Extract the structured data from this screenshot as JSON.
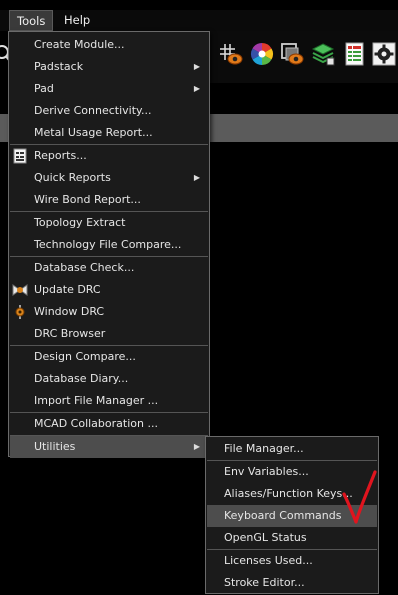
{
  "menubar": {
    "items": [
      {
        "label": "Tools",
        "active": true
      },
      {
        "label": "Help",
        "active": false
      }
    ]
  },
  "tools_menu": {
    "items": [
      {
        "label": "Create Module...",
        "submenu": false
      },
      {
        "label": "Padstack",
        "submenu": true
      },
      {
        "label": "Pad",
        "submenu": true
      },
      {
        "label": "Derive Connectivity...",
        "submenu": false
      },
      {
        "label": "Metal Usage Report...",
        "submenu": false
      },
      {
        "label": "Reports...",
        "submenu": false,
        "icon": "report-icon"
      },
      {
        "label": "Quick Reports",
        "submenu": true
      },
      {
        "label": "Wire Bond Report...",
        "submenu": false
      },
      {
        "label": "Topology Extract",
        "submenu": false
      },
      {
        "label": "Technology File Compare...",
        "submenu": false
      },
      {
        "label": "Database Check...",
        "submenu": false
      },
      {
        "label": "Update DRC",
        "submenu": false,
        "icon": "update-drc-icon"
      },
      {
        "label": "Window DRC",
        "submenu": false,
        "icon": "window-drc-icon"
      },
      {
        "label": "DRC Browser",
        "submenu": false
      },
      {
        "label": "Design Compare...",
        "submenu": false
      },
      {
        "label": "Database Diary...",
        "submenu": false
      },
      {
        "label": "Import File Manager ...",
        "submenu": false
      },
      {
        "label": "MCAD Collaboration ...",
        "submenu": false
      },
      {
        "label": "Utilities",
        "submenu": true,
        "highlighted": true
      }
    ]
  },
  "utilities_menu": {
    "items": [
      {
        "label": "File Manager..."
      },
      {
        "label": "Env Variables..."
      },
      {
        "label": "Aliases/Function Keys..."
      },
      {
        "label": "Keyboard Commands",
        "highlighted": true
      },
      {
        "label": "OpenGL Status"
      },
      {
        "label": "Licenses Used..."
      },
      {
        "label": "Stroke Editor..."
      }
    ]
  },
  "submenu_arrow": "▶",
  "colors": {
    "menu_bg": "#1b1b1b",
    "highlight": "#4d4d4d",
    "annotation_check": "#e0141e"
  }
}
